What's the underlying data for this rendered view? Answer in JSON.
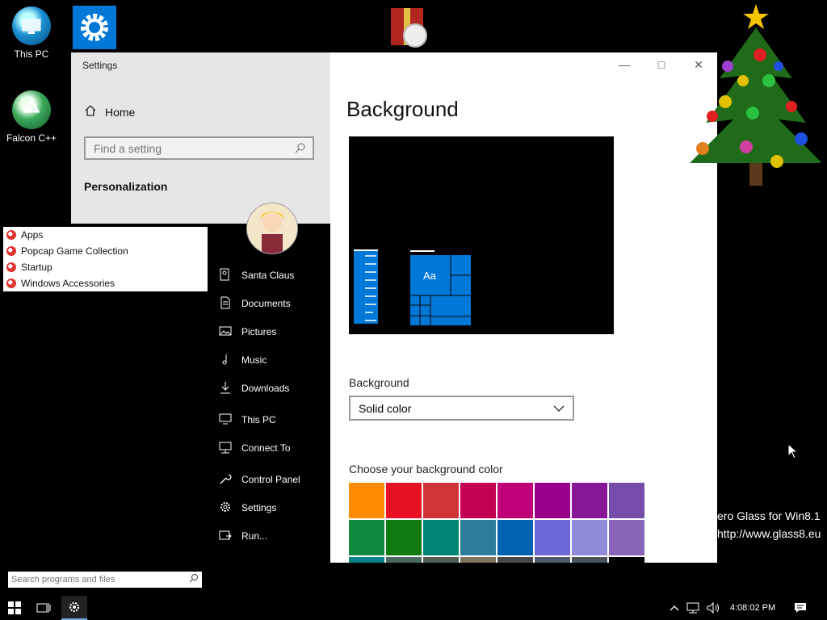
{
  "desktop": {
    "icons": [
      {
        "label": "This PC"
      },
      {
        "label": "Falcon C++"
      }
    ],
    "watermark": [
      "ero Glass for Win8.1",
      "http://www.glass8.eu"
    ]
  },
  "settings": {
    "window_title": "Settings",
    "home_label": "Home",
    "search_placeholder": "Find a setting",
    "section_title": "Personalization",
    "page_title": "Background",
    "preview_tile_text": "Aa",
    "background_label": "Background",
    "background_value": "Solid color",
    "color_label": "Choose your background color",
    "swatches": [
      "#ff8c00",
      "#e81123",
      "#d13438",
      "#c30052",
      "#bf0077",
      "#9a0089",
      "#881798",
      "#744da9",
      "#10893e",
      "#107c10",
      "#018574",
      "#2d7d9a",
      "#0063b1",
      "#6b69d6",
      "#8e8cd8",
      "#8764b8",
      "#038387",
      "#486860",
      "#525e54",
      "#7e735f",
      "#4c4a48",
      "#515c6b",
      "#4a5459",
      "#000000"
    ]
  },
  "start_menu": {
    "programs": [
      "Apps",
      "Popcap Game Collection",
      "Startup",
      "Windows Accessories"
    ],
    "links": [
      "Santa Claus",
      "Documents",
      "Pictures",
      "Music",
      "Downloads",
      "This PC",
      "Connect To",
      "Control Panel",
      "Settings",
      "Run..."
    ],
    "search_placeholder": "Search programs and files"
  },
  "taskbar": {
    "clock": "4:08:02 PM"
  }
}
